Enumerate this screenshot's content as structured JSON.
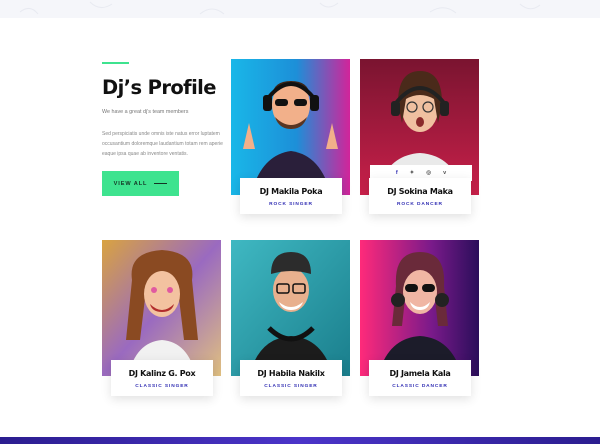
{
  "intro": {
    "title": "Dj’s Profile",
    "subtitle": "We have a great dj’s team members",
    "description": "Sed perspiciatis unde omnis iste natus error luptatem occusantium doloremque laudantium totam rem aperie eaque ipsa quae ab inventore ventatis.",
    "button_label": "VIEW ALL"
  },
  "team": [
    {
      "name": "DJ Makila Poka",
      "role": "ROCK SINGER"
    },
    {
      "name": "DJ Sokina Maka",
      "role": "ROCK DANCER"
    },
    {
      "name": "DJ Kalinz G. Pox",
      "role": "CLASSIC SINGER"
    },
    {
      "name": "DJ Habila Nakilx",
      "role": "CLASSIC SINGER"
    },
    {
      "name": "DJ Jamela Kala",
      "role": "CLASSIC DANCER"
    }
  ],
  "social_icons": [
    "facebook-icon",
    "twitter-icon",
    "instagram-icon",
    "vimeo-icon"
  ],
  "colors": {
    "accent_green": "#3ee38f",
    "role_blue": "#2e2bb2",
    "footer_purple": "#3a28b0"
  }
}
